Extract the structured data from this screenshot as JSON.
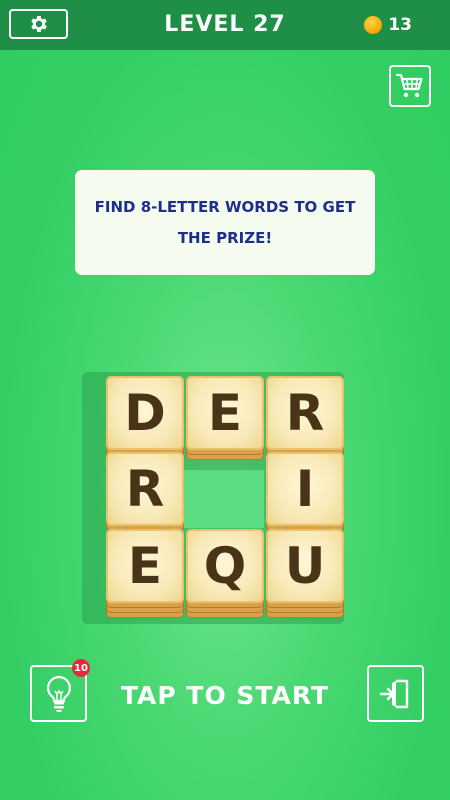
{
  "header": {
    "level_title": "LEVEL 27",
    "coin_count": "13",
    "settings_icon": "gear-icon",
    "coin_icon": "coin-icon"
  },
  "shop": {
    "icon": "cart-icon"
  },
  "hint_card": {
    "text": "FIND 8-LETTER WORDS TO GET THE PRIZE!"
  },
  "board": {
    "rows": [
      [
        "D",
        "E",
        "R"
      ],
      [
        "R",
        "",
        "I"
      ],
      [
        "E",
        "Q",
        "U"
      ]
    ],
    "stack_heights": [
      [
        3,
        2,
        1
      ],
      [
        1,
        0,
        1
      ],
      [
        3,
        3,
        3
      ]
    ]
  },
  "footer": {
    "hint_icon": "lightbulb-icon",
    "hint_count": "10",
    "start_label": "TAP TO START",
    "exit_icon": "exit-icon"
  },
  "colors": {
    "background": "#35d066",
    "topbar": "#1f8e46",
    "tile_face": "#f8e9b7",
    "tile_side": "#d9a24a",
    "letter": "#4a3418",
    "hint_text": "#1d2f8a",
    "badge": "#e52b3a"
  }
}
